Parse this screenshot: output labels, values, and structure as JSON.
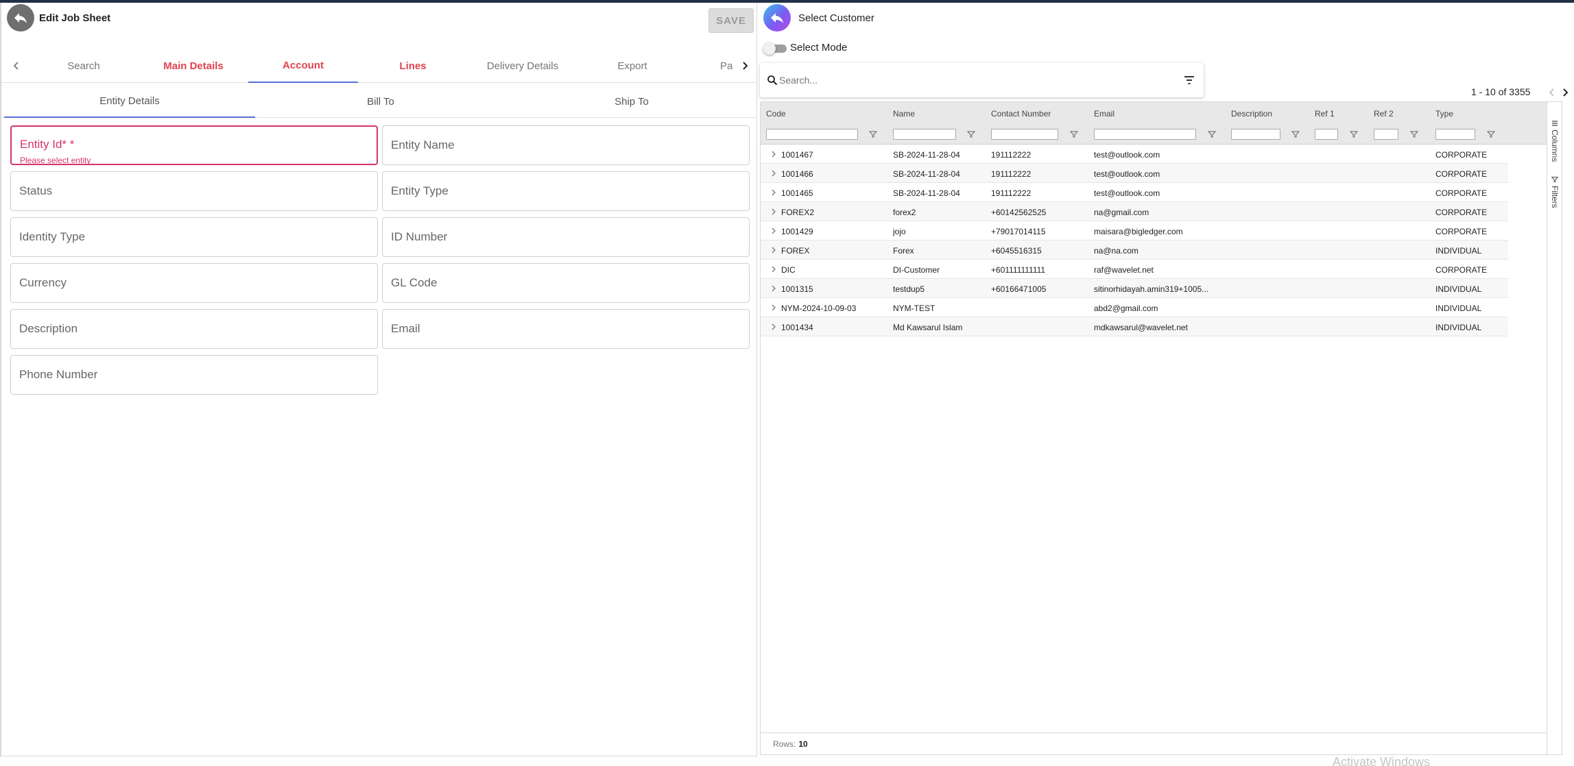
{
  "left": {
    "title": "Edit Job Sheet",
    "save_label": "SAVE",
    "tabs": [
      "Search",
      "Main Details",
      "Account",
      "Lines",
      "Delivery Details",
      "Export",
      "Pa"
    ],
    "subtabs": [
      "Entity Details",
      "Bill To",
      "Ship To"
    ],
    "fields": {
      "entity_id": "Entity Id* *",
      "entity_id_hint": "Please select entity",
      "entity_name": "Entity Name",
      "status": "Status",
      "entity_type": "Entity Type",
      "identity_type": "Identity Type",
      "id_number": "ID Number",
      "currency": "Currency",
      "gl_code": "GL Code",
      "description": "Description",
      "email": "Email",
      "phone_number": "Phone Number"
    }
  },
  "right": {
    "title": "Select Customer",
    "select_mode_label": "Select Mode",
    "search_placeholder": "Search...",
    "pager_text": "1 - 10 of 3355",
    "columns": [
      "Code",
      "Name",
      "Contact Number",
      "Email",
      "Description",
      "Ref 1",
      "Ref 2",
      "Type"
    ],
    "rows": [
      [
        "1001467",
        "SB-2024-11-28-04",
        "191112222",
        "test@outlook.com",
        "",
        "",
        "",
        "CORPORATE"
      ],
      [
        "1001466",
        "SB-2024-11-28-04",
        "191112222",
        "test@outlook.com",
        "",
        "",
        "",
        "CORPORATE"
      ],
      [
        "1001465",
        "SB-2024-11-28-04",
        "191112222",
        "test@outlook.com",
        "",
        "",
        "",
        "CORPORATE"
      ],
      [
        "FOREX2",
        "forex2",
        "+60142562525",
        "na@gmail.com",
        "",
        "",
        "",
        "CORPORATE"
      ],
      [
        "1001429",
        "jojo",
        "+79017014115",
        "maisara@bigledger.com",
        "",
        "",
        "",
        "CORPORATE"
      ],
      [
        "FOREX",
        "Forex",
        "+6045516315",
        "na@na.com",
        "",
        "",
        "",
        "INDIVIDUAL"
      ],
      [
        "DIC",
        "DI-Customer",
        "+601111111111",
        "raf@wavelet.net",
        "",
        "",
        "",
        "CORPORATE"
      ],
      [
        "1001315",
        "testdup5",
        "+60166471005",
        "sitinorhidayah.amin319+1005...",
        "",
        "",
        "",
        "INDIVIDUAL"
      ],
      [
        "NYM-2024-10-09-03",
        "NYM-TEST",
        "",
        "abd2@gmail.com",
        "",
        "",
        "",
        "INDIVIDUAL"
      ],
      [
        "1001434",
        "Md Kawsarul Islam",
        "",
        "mdkawsarul@wavelet.net",
        "",
        "",
        "",
        "INDIVIDUAL"
      ]
    ],
    "side_columns_label": "Columns",
    "side_filters_label": "Filters",
    "rows_label": "Rows:",
    "rows_value": "10"
  },
  "watermark": "Activate Windows",
  "colors": {
    "accent_red": "#e0434f",
    "tab_underline": "#5b6fd8",
    "error": "#d6336c",
    "header_bar": "#1f3147"
  },
  "icons": [
    "back-arrow-icon",
    "chevron-left-icon",
    "chevron-right-icon",
    "search-icon",
    "filter-lines-icon",
    "funnel-icon",
    "columns-icon"
  ]
}
